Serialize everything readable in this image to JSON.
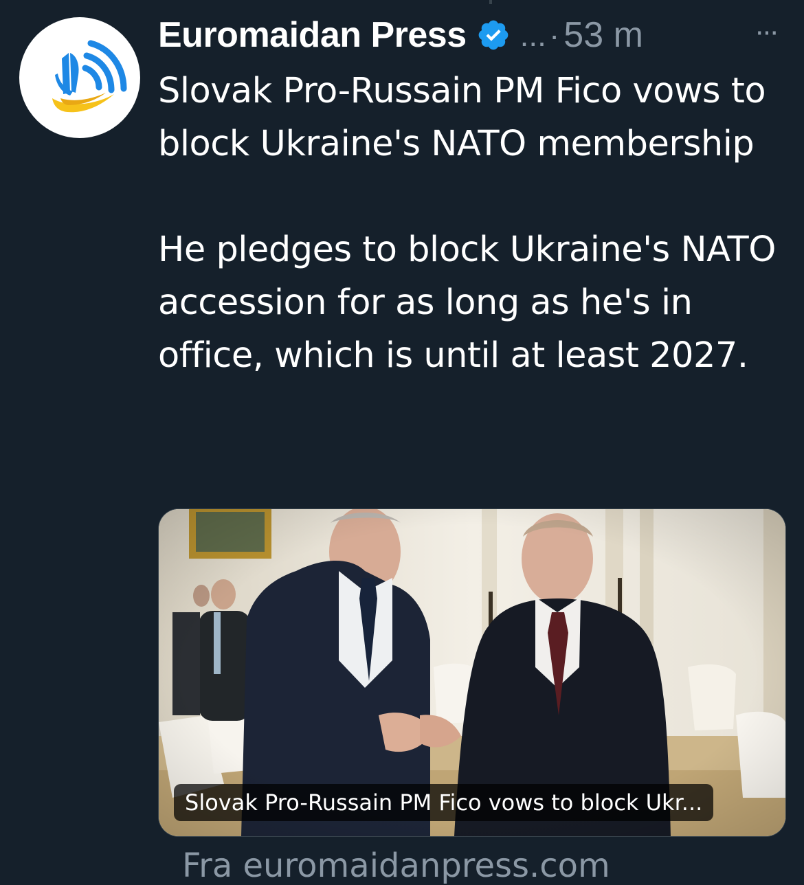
{
  "tweet": {
    "author": {
      "name": "Euromaidan Press",
      "handle": "...",
      "separator": "·",
      "time": "53 m",
      "verified": true,
      "avatar_icon": "euromaidan-logo-icon"
    },
    "more_icon": "more-dots-icon",
    "more_label": "···",
    "text": {
      "paragraph_1": "Slovak Pro-Russain PM Fico vows to block Ukraine's NATO membership",
      "paragraph_2": "He pledges to block Ukraine's NATO accession for as long as he's in office, which is until at least 2027."
    },
    "card": {
      "caption": "Slovak Pro-Russain PM Fico vows to block Ukr..."
    },
    "source": "Fra euromaidanpress.com"
  },
  "colors": {
    "background": "#15202b",
    "text": "#ffffff",
    "secondary": "#8b98a5",
    "verified": "#1d9bf0",
    "logo_blue": "#1e88e5",
    "logo_yellow": "#f6c21a"
  }
}
